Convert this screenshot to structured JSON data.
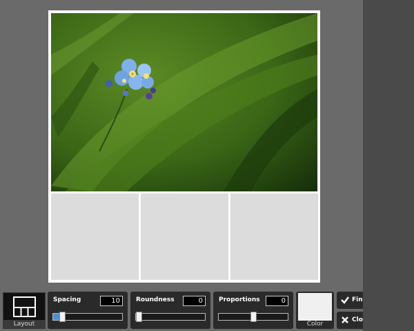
{
  "canvas": {
    "frame_color": "#ffffff",
    "placeholder_color": "#dcdcdc"
  },
  "toolbar": {
    "layout": {
      "label": "Layout",
      "icon": "grid-layout-icon"
    },
    "spacing": {
      "label": "Spacing",
      "value": "10",
      "slider_fraction": 0.1,
      "accent": "#4a90d9"
    },
    "roundness": {
      "label": "Roundness",
      "value": "0",
      "slider_fraction": 0.0
    },
    "proportions": {
      "label": "Proportions",
      "value": "0",
      "slider_fraction": 0.5
    },
    "color": {
      "label": "Color",
      "swatch": "#f0f0f0"
    },
    "finish": {
      "label": "Fini",
      "icon": "checkmark-icon"
    },
    "close": {
      "label": "Close",
      "icon": "close-icon"
    }
  }
}
